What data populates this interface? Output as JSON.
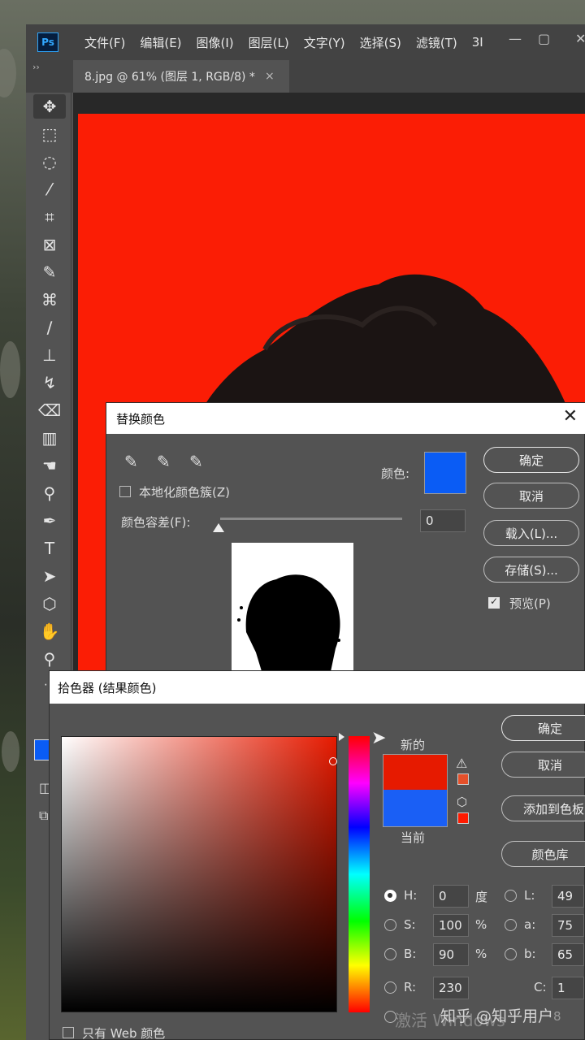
{
  "menubar": {
    "items": [
      "文件(F)",
      "编辑(E)",
      "图像(I)",
      "图层(L)",
      "文字(Y)",
      "选择(S)",
      "滤镜(T)",
      "3I"
    ],
    "logo": "Ps"
  },
  "document_tab": {
    "title": "8.jpg @ 61% (图层 1, RGB/8) *",
    "close": "×"
  },
  "replace_dialog": {
    "title": "替换颜色",
    "localized_clusters": "本地化颜色簇(Z)",
    "color_label": "颜色:",
    "tolerance_label": "颜色容差(F):",
    "tolerance_value": "0",
    "ok": "确定",
    "cancel": "取消",
    "load": "载入(L)...",
    "save": "存储(S)...",
    "preview": "预览(P)",
    "preview_checked": true,
    "swatch_color": "#0a5cf5"
  },
  "picker_dialog": {
    "title": "拾色器 (结果颜色)",
    "new_label": "新的",
    "current_label": "当前",
    "ok": "确定",
    "cancel": "取消",
    "add_to_swatches": "添加到色板",
    "color_libraries": "颜色库",
    "web_only": "只有 Web 颜色",
    "new_color": "#e61a00",
    "current_color": "#1a5ff5",
    "H": "0",
    "H_unit": "度",
    "S": "100",
    "S_unit": "%",
    "B": "90",
    "B_unit": "%",
    "R": "230",
    "L": "49",
    "a": "75",
    "b": "65",
    "C": "1",
    "bottom_right_value": "8"
  },
  "watermark": {
    "activate": "激活 Windows",
    "zhihu": "知乎 @知乎用户"
  },
  "colors": {
    "canvas_red": "#fb1d05",
    "ps_blue": "#31a8ff",
    "fg_swatch": "#0a5cf5"
  }
}
